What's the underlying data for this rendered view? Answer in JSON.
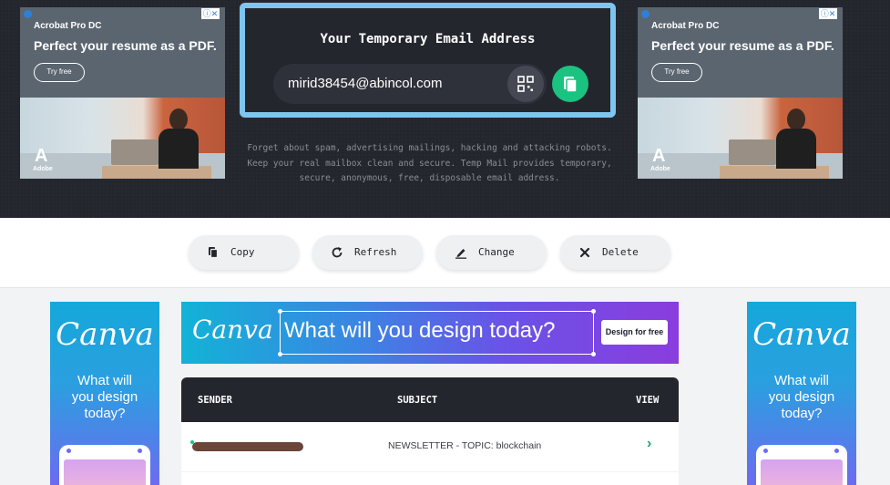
{
  "ads": {
    "adobe": {
      "brand": "Acrobat Pro DC",
      "headline": "Perfect your resume as a PDF.",
      "cta": "Try free",
      "info_label": "ⓘ✕",
      "logo_word": "Adobe"
    },
    "canva_side": {
      "logo": "Canva",
      "tagline": "What will you design today?"
    },
    "canva_banner": {
      "logo": "Canva",
      "text": "What will you design today?",
      "cta": "Design for free"
    }
  },
  "email": {
    "title": "Your Temporary Email Address",
    "address": "mirid38454@abincol.com",
    "description": "Forget about spam, advertising mailings, hacking and attacking robots. Keep your real mailbox clean and secure. Temp Mail provides temporary, secure, anonymous, free, disposable email address."
  },
  "actions": [
    {
      "label": "Copy",
      "icon": "copy-icon"
    },
    {
      "label": "Refresh",
      "icon": "refresh-icon"
    },
    {
      "label": "Change",
      "icon": "edit-icon"
    },
    {
      "label": "Delete",
      "icon": "close-icon"
    }
  ],
  "inbox": {
    "columns": {
      "sender": "SENDER",
      "subject": "SUBJECT",
      "view": "VIEW"
    },
    "rows": [
      {
        "sender": "",
        "subject": "NEWSLETTER - TOPIC: blockchain",
        "view": "›"
      }
    ]
  }
}
